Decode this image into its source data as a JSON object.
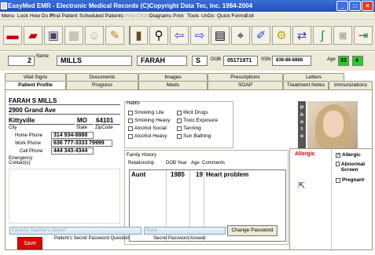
{
  "window": {
    "title": "EasyMed EMR - Electronic Medical Records (C)Copyright Data Tec, Inc. 1984-2004"
  },
  "menu": [
    "Menu",
    "Lock",
    "How Do I?",
    "Find Patient",
    "Scheduled Patients",
    "View Charts",
    "Diagrams",
    "Print",
    "Tools",
    "UnDo",
    "Quick Forms",
    "Exit"
  ],
  "patient_bar": {
    "number": "2",
    "name_label": "Name",
    "last_name": "MILLS",
    "first_name": "FARAH",
    "middle_initial": "S",
    "dob_label": "DOB",
    "dob": "05171971",
    "ssn_label": "SSN",
    "ssn": "838-88-8888",
    "age_label": "Age",
    "age": "33",
    "age_flag": "4"
  },
  "tabs_row1": [
    "Vital Signs",
    "Documents",
    "Images",
    "Prescriptions",
    "Letters"
  ],
  "tabs_row2": [
    "Patient Profile",
    "Progress",
    "Meds",
    "SOAP",
    "Treatment Notes",
    "Immunizations"
  ],
  "active_tab": "Patient Profile",
  "profile": {
    "full_name": "FARAH S MILLS",
    "address": "2900 Grand Ave",
    "city": "Kittyville",
    "state": "MO",
    "zip": "64101",
    "city_label": "City",
    "state_label": "State",
    "zip_label": "ZipCode",
    "home_phone_label": "Home Phone",
    "home_phone": "314 934-8888",
    "work_phone_label": "Work Phone",
    "work_phone": "636 777-3333 79999",
    "cell_phone_label": "Cell Phone",
    "cell_phone": "444 343-4344",
    "emergency_label": "Emergency Contact(s)"
  },
  "habits": {
    "title": "Habits",
    "items": [
      "Smoking Lite",
      "Illicit Drugs",
      "Smoking Heavy",
      "Toxic Exposure",
      "Alcohol Social",
      "Tanning",
      "Alcohol Heavy",
      "Sun Bathing"
    ]
  },
  "family_history": {
    "title": "Family History",
    "columns": [
      "Relationship",
      "DOB Year",
      "Age",
      "Comments"
    ],
    "rows": [
      {
        "relationship": "Aunt",
        "dob_year": "1985",
        "age": "19",
        "comments": "Heart problem"
      }
    ]
  },
  "photo": {
    "label": "Photo"
  },
  "allergy": {
    "header": "Allergic",
    "checks": [
      {
        "label": "Allergic",
        "checked": true
      },
      {
        "label": "Abnormal Screen",
        "checked": false
      },
      {
        "label": "Pregnant",
        "checked": false
      }
    ]
  },
  "password": {
    "question_placeholder": "Favorite Teacher's Name?",
    "answer_placeholder": "Rose",
    "question_label": "Patient's Secret Password Question",
    "answer_label": "Secret Password Answer",
    "change_button": "Change Password"
  },
  "save_button": "Save",
  "colors": {
    "title_bar": "#2350b8",
    "age_badge": "#30c830",
    "allergic_text": "#e00000",
    "save_button": "#e00000"
  }
}
